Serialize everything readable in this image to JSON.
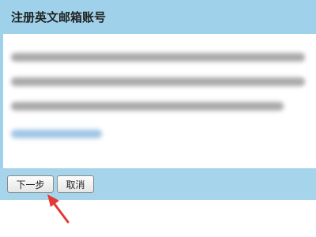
{
  "dialog": {
    "title": "注册英文邮箱账号",
    "next_label": "下一步",
    "cancel_label": "取消"
  },
  "colors": {
    "header_bg": "#9fd2ea",
    "footer_bg": "#a6d4ea",
    "annotation_arrow": "#e53935"
  },
  "icons": {
    "annotation": "red-arrow-icon"
  }
}
